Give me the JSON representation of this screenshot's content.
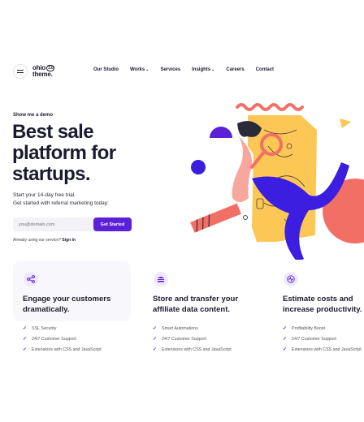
{
  "nav": {
    "logo_line1": "ohio",
    "logo_tag": "3.0",
    "logo_line2": "theme.",
    "items": [
      {
        "label": "Our Studio",
        "has_dropdown": false
      },
      {
        "label": "Works",
        "has_dropdown": true
      },
      {
        "label": "Services",
        "has_dropdown": false
      },
      {
        "label": "Insights",
        "has_dropdown": true
      },
      {
        "label": "Careers",
        "has_dropdown": false
      },
      {
        "label": "Contact",
        "has_dropdown": false
      }
    ]
  },
  "hero": {
    "eyebrow": "Show me a demo",
    "title_line1": "Best sale",
    "title_line2": "platform for",
    "title_line3": "startups.",
    "sub_line1": "Start your 14-day free trial.",
    "sub_line2": "Get started with referral marketing today:",
    "email_placeholder": "you@domain.com",
    "cta_label": "Get Started",
    "signin_prefix": "Already using our service?",
    "signin_link": "Sign In"
  },
  "features": [
    {
      "icon": "share-nodes-icon",
      "heading_line1": "Engage your customers",
      "heading_line2": "dramatically.",
      "items": [
        "SSL Security",
        "24/7 Customer Support",
        "Extensions with CSS and JavaScript"
      ]
    },
    {
      "icon": "burger-icon",
      "heading_line1": "Store and transfer your",
      "heading_line2": "affiliate data content.",
      "items": [
        "Smart Automations",
        "24/7 Customer Support",
        "Extensions with CSS and JavaScript"
      ]
    },
    {
      "icon": "pulse-icon",
      "heading_line1": "Estimate costs and",
      "heading_line2": "increase productivity.",
      "items": [
        "Profitability Boost",
        "24/7 Customer Support",
        "Extensions with CSS and JavaScript"
      ]
    }
  ],
  "colors": {
    "accent": "#5a21d9",
    "coral": "#f26f66",
    "yellow": "#fdc756",
    "blue": "#3b1ee0"
  }
}
